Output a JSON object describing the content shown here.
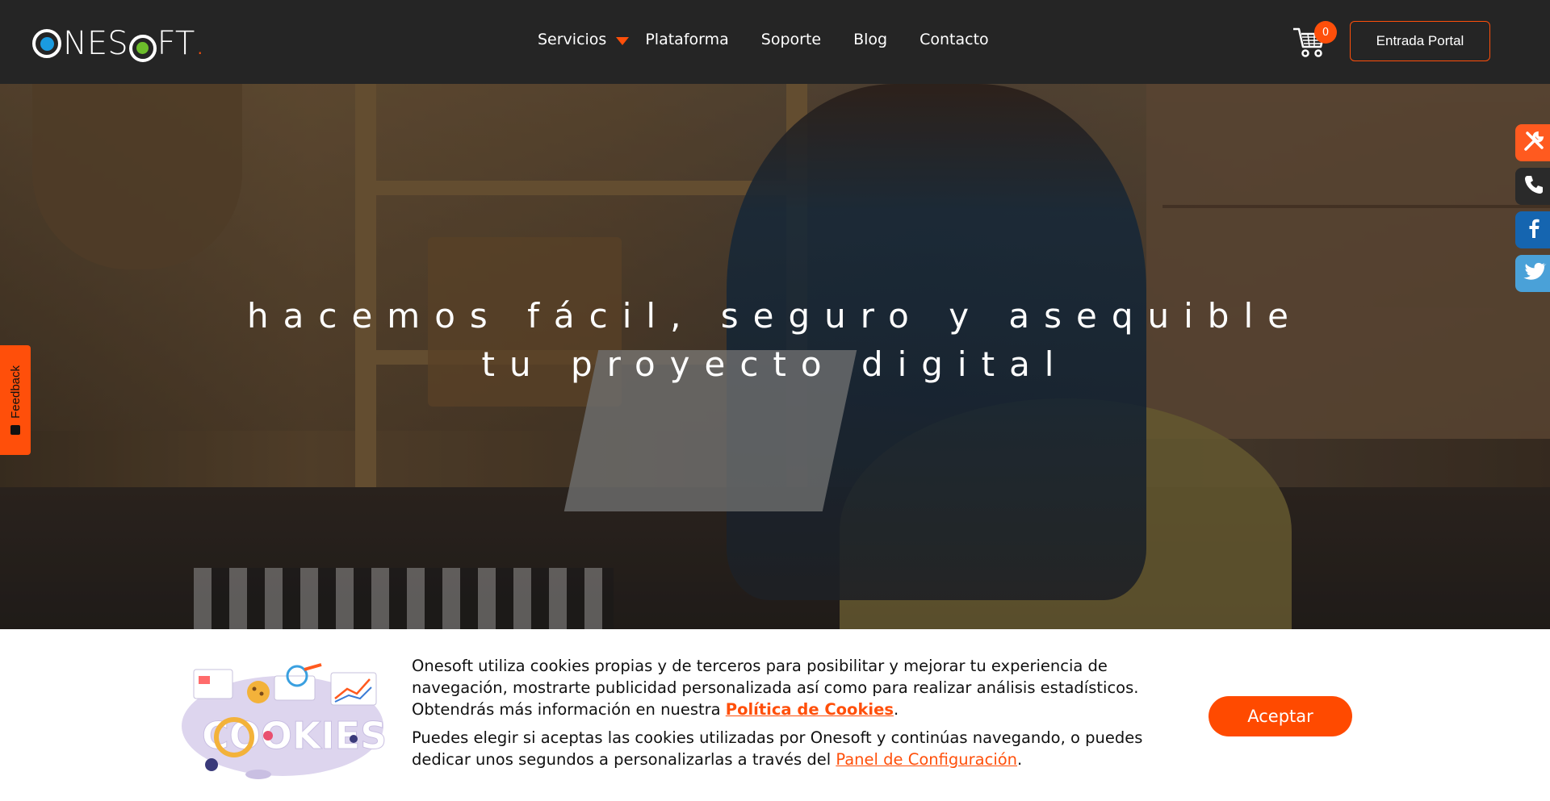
{
  "brand": {
    "logo_text": "ONESOFT",
    "logo_dot": ".",
    "colors": {
      "accent": "#ff4f0a",
      "blue": "#1a9be0",
      "green": "#6cbd2b",
      "header_bg": "#252525"
    }
  },
  "nav": {
    "items": [
      {
        "label": "Servicios",
        "has_dropdown": true
      },
      {
        "label": "Plataforma"
      },
      {
        "label": "Soporte"
      },
      {
        "label": "Blog"
      },
      {
        "label": "Contacto"
      }
    ]
  },
  "cart": {
    "count": "0",
    "icon": "cart-icon"
  },
  "portal_button": {
    "label": "Entrada Portal"
  },
  "hero": {
    "line1": "hacemos fácil, seguro y asequible",
    "line2": "tu proyecto digital"
  },
  "side_buttons": [
    {
      "icon": "tools-icon",
      "color": "#ff5a1f"
    },
    {
      "icon": "phone-icon",
      "color": "#2a2a2a"
    },
    {
      "icon": "facebook-icon",
      "color": "#1565b0"
    },
    {
      "icon": "twitter-icon",
      "color": "#4aa1d8"
    }
  ],
  "feedback": {
    "label": "Feedback"
  },
  "cookie_banner": {
    "image_text": "COOKIES",
    "para1_text": "Onesoft utiliza cookies propias y de terceros para posibilitar y mejorar tu experiencia de navegación, mostrarte publicidad personalizada así como para realizar análisis estadísticos. Obtendrás más información en nuestra ",
    "para1_link": "Política de Cookies",
    "para1_end": ".",
    "para2_text": "Puedes elegir si aceptas las cookies utilizadas por Onesoft y continúas navegando, o puedes dedicar unos segundos a personalizarlas a través del ",
    "para2_link": "Panel de Configuración",
    "para2_end": ".",
    "accept_label": "Aceptar"
  }
}
